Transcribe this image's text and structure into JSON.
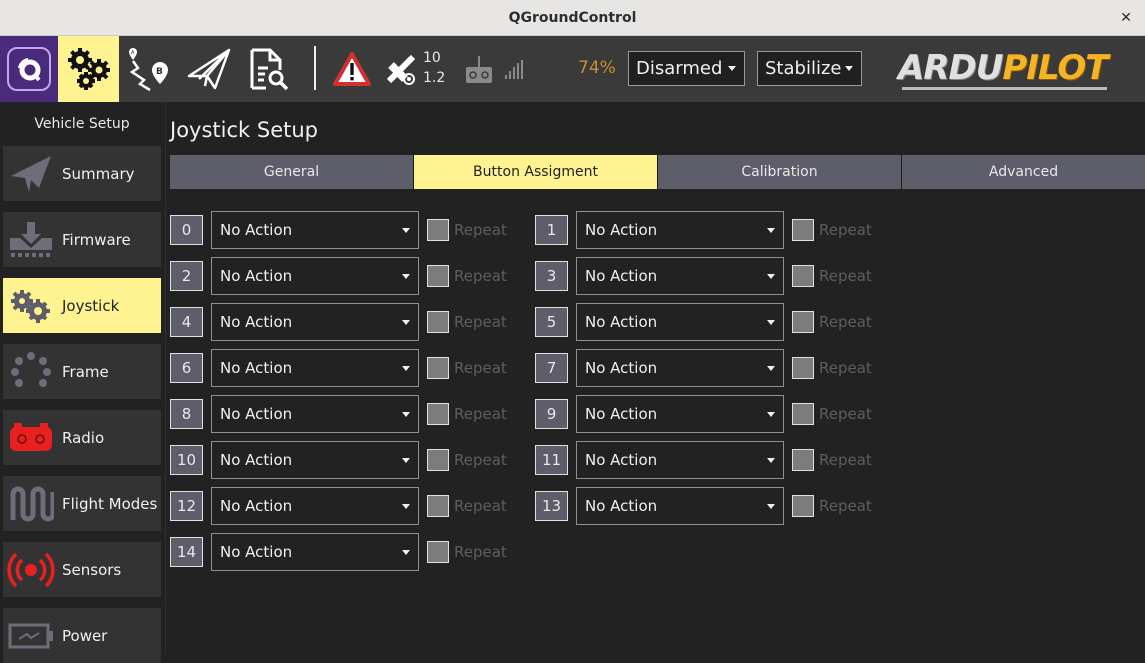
{
  "window": {
    "title": "QGroundControl",
    "close_icon": "close-icon"
  },
  "toolbar": {
    "icons": [
      "qgc-logo-icon",
      "vehicle-setup-gears-icon",
      "plan-route-icon",
      "fly-paper-plane-icon",
      "analyze-document-icon",
      "warning-icon",
      "gps-satellite-icon",
      "rc-transmitter-icon",
      "signal-strength-icon"
    ],
    "gps_count": "10",
    "gps_hdop": "1.2",
    "battery": "74%",
    "battery_color": "#c8902c",
    "arm_state": "Disarmed",
    "flight_mode": "Stabilize",
    "brand_left": "ARDU",
    "brand_right": "PILOT"
  },
  "sidebar": {
    "heading": "Vehicle Setup",
    "items": [
      {
        "label": "Summary",
        "icon": "paper-plane-icon",
        "active": false
      },
      {
        "label": "Firmware",
        "icon": "download-icon",
        "active": false
      },
      {
        "label": "Joystick",
        "icon": "gears-icon",
        "active": true
      },
      {
        "label": "Frame",
        "icon": "frame-dots-icon",
        "active": false
      },
      {
        "label": "Radio",
        "icon": "radio-icon",
        "active": false
      },
      {
        "label": "Flight Modes",
        "icon": "wave-icon",
        "active": false
      },
      {
        "label": "Sensors",
        "icon": "sensors-icon",
        "active": false
      },
      {
        "label": "Power",
        "icon": "battery-icon",
        "active": false
      }
    ]
  },
  "main": {
    "title": "Joystick Setup",
    "tabs": [
      {
        "label": "General",
        "active": false
      },
      {
        "label": "Button Assigment",
        "active": true
      },
      {
        "label": "Calibration",
        "active": false
      },
      {
        "label": "Advanced",
        "active": false
      }
    ],
    "repeat_label": "Repeat",
    "buttons": [
      {
        "num": "0",
        "action": "No Action",
        "repeat": false
      },
      {
        "num": "1",
        "action": "No Action",
        "repeat": false
      },
      {
        "num": "2",
        "action": "No Action",
        "repeat": false
      },
      {
        "num": "3",
        "action": "No Action",
        "repeat": false
      },
      {
        "num": "4",
        "action": "No Action",
        "repeat": false
      },
      {
        "num": "5",
        "action": "No Action",
        "repeat": false
      },
      {
        "num": "6",
        "action": "No Action",
        "repeat": false
      },
      {
        "num": "7",
        "action": "No Action",
        "repeat": false
      },
      {
        "num": "8",
        "action": "No Action",
        "repeat": false
      },
      {
        "num": "9",
        "action": "No Action",
        "repeat": false
      },
      {
        "num": "10",
        "action": "No Action",
        "repeat": false
      },
      {
        "num": "11",
        "action": "No Action",
        "repeat": false
      },
      {
        "num": "12",
        "action": "No Action",
        "repeat": false
      },
      {
        "num": "13",
        "action": "No Action",
        "repeat": false
      },
      {
        "num": "14",
        "action": "No Action",
        "repeat": false
      }
    ]
  },
  "colors": {
    "accent": "#fff291",
    "toolbar_bg": "#3a3a3a",
    "logo_bg": "#4a2a7a",
    "tab_bg": "#5e5d6a",
    "alert_red": "#e02020",
    "brand_orange": "#f5b426"
  }
}
